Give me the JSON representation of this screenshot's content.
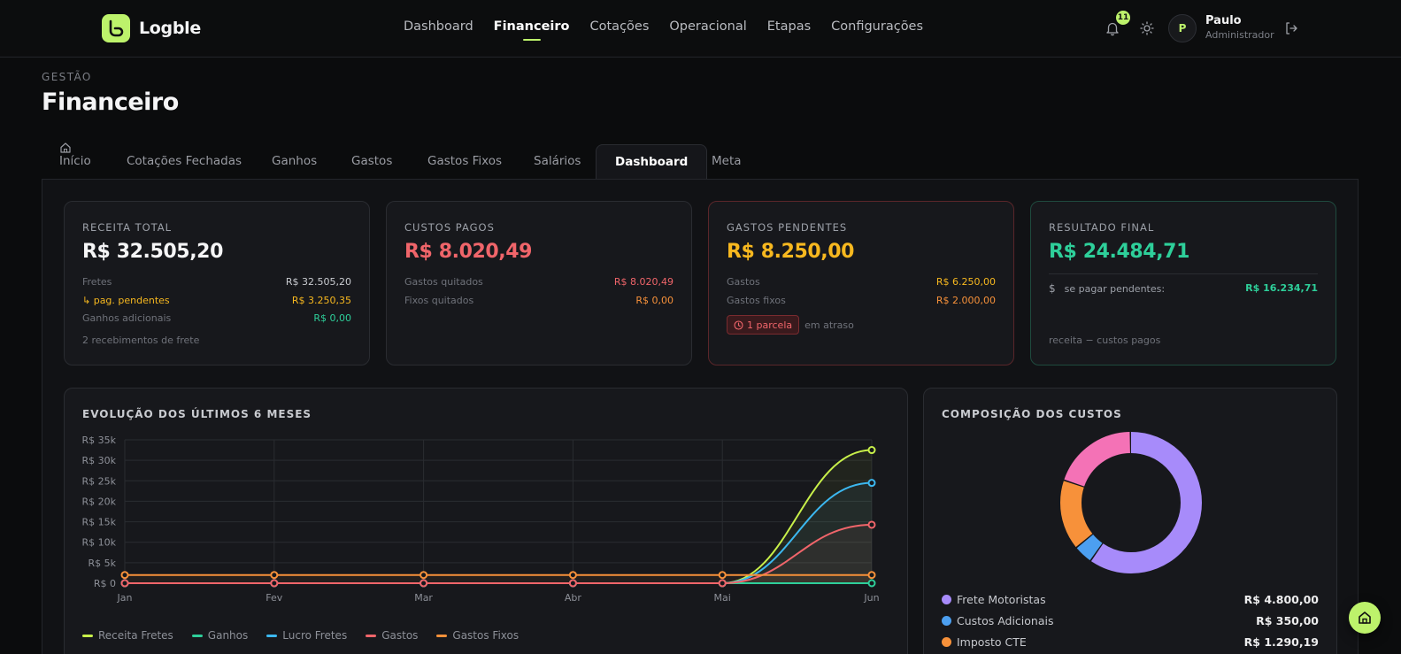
{
  "app": {
    "name": "Logble"
  },
  "nav": [
    "Dashboard",
    "Financeiro",
    "Cotações",
    "Operacional",
    "Etapas",
    "Configurações"
  ],
  "nav_active": "Financeiro",
  "header": {
    "notification_count": "11",
    "user_initial": "P",
    "user_name": "Paulo",
    "user_role": "Administrador"
  },
  "page": {
    "eyebrow": "GESTÃO",
    "title": "Financeiro"
  },
  "tabs": [
    "Início",
    "Cotações Fechadas",
    "Ganhos",
    "Gastos",
    "Gastos Fixos",
    "Salários",
    "Dashboard",
    "Meta"
  ],
  "tab_active": "Dashboard",
  "cards": {
    "receita": {
      "label": "RECEITA TOTAL",
      "value": "R$ 32.505,20",
      "fretes_label": "Fretes",
      "fretes_value": "R$ 32.505,20",
      "pendentes_label": "↳ pag. pendentes",
      "pendentes_value": "R$ 3.250,35",
      "ganhos_label": "Ganhos adicionais",
      "ganhos_value": "R$ 0,00",
      "note": "2 recebimentos de frete"
    },
    "custos": {
      "label": "CUSTOS PAGOS",
      "value": "R$ 8.020,49",
      "gastos_label": "Gastos quitados",
      "gastos_value": "R$ 8.020,49",
      "fixos_label": "Fixos quitados",
      "fixos_value": "R$ 0,00"
    },
    "pendentes": {
      "label": "GASTOS PENDENTES",
      "value": "R$ 8.250,00",
      "gastos_label": "Gastos",
      "gastos_value": "R$ 6.250,00",
      "fixos_label": "Gastos fixos",
      "fixos_value": "R$ 2.000,00",
      "tag": "1 parcela",
      "tag_note": "em atraso"
    },
    "resultado": {
      "label": "RESULTADO FINAL",
      "value": "R$ 24.484,71",
      "sepagar_label": "se pagar pendentes:",
      "sepagar_value": "R$ 16.234,71",
      "note": "receita − custos pagos"
    }
  },
  "colors": {
    "accent": "#bdf26b",
    "white": "#f5f5f6",
    "red": "#f0656a",
    "orange": "#f7913a",
    "amber": "#f7b81f",
    "green": "#2ecf9a",
    "blue": "#3cb8f0"
  },
  "chart_data": {
    "type": "line",
    "title": "EVOLUÇÃO DOS ÚLTIMOS 6 MESES",
    "categories": [
      "Jan",
      "Fev",
      "Mar",
      "Abr",
      "Mai",
      "Jun"
    ],
    "y_ticks": [
      "R$ 0",
      "R$ 5k",
      "R$ 10k",
      "R$ 15k",
      "R$ 20k",
      "R$ 25k",
      "R$ 30k",
      "R$ 35k"
    ],
    "ylim": [
      0,
      35000
    ],
    "grid": true,
    "series": [
      {
        "name": "Receita Fretes",
        "color": "#c8f04a",
        "values": [
          0,
          0,
          0,
          0,
          0,
          32505
        ]
      },
      {
        "name": "Ganhos",
        "color": "#2ecf9a",
        "values": [
          0,
          0,
          0,
          0,
          0,
          0
        ]
      },
      {
        "name": "Lucro Fretes",
        "color": "#3cb8f0",
        "values": [
          0,
          0,
          0,
          0,
          0,
          24485
        ]
      },
      {
        "name": "Gastos",
        "color": "#f0656a",
        "values": [
          0,
          0,
          0,
          0,
          0,
          14270
        ]
      },
      {
        "name": "Gastos Fixos",
        "color": "#f7913a",
        "values": [
          2000,
          2000,
          2000,
          2000,
          2000,
          2000
        ]
      }
    ]
  },
  "pie": {
    "title": "COMPOSIÇÃO DOS CUSTOS",
    "chart_data": {
      "type": "pie",
      "series": [
        {
          "name": "Frete Motoristas",
          "value": 4800,
          "label": "R$ 4.800,00",
          "color": "#a78bfa"
        },
        {
          "name": "Custos Adicionais",
          "value": 350,
          "label": "R$ 350,00",
          "color": "#4c9ff0"
        },
        {
          "name": "Imposto CTE",
          "value": 1290.19,
          "label": "R$ 1.290,19",
          "color": "#f7913a"
        },
        {
          "value": 1580.3,
          "color": "#f472b6"
        }
      ]
    }
  },
  "icons": {
    "bell": "bell-icon",
    "theme": "sun-icon",
    "logout": "logout-icon",
    "home": "home-icon",
    "dollar": "dollar-icon",
    "clock": "clock-icon"
  }
}
